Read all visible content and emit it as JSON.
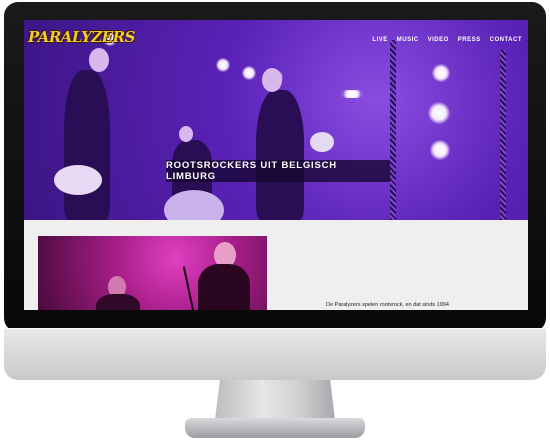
{
  "site": {
    "logo": "PARALYZERS",
    "nav": [
      "LIVE",
      "MUSIC",
      "VIDEO",
      "PRESS",
      "CONTACT"
    ],
    "tagline": "ROOTSROCKERS UIT BELGISCH LIMBURG",
    "intro_text": "De Paralyzers spelen rootsrock, en dat sinds 1994"
  },
  "colors": {
    "hero_purple": "#5a22b8",
    "logo_yellow": "#f2cc2e",
    "photo_magenta": "#a81e8a"
  }
}
